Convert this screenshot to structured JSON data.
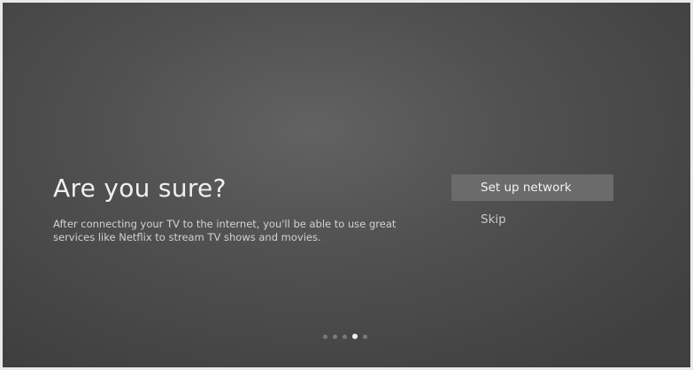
{
  "dialog": {
    "title": "Are you sure?",
    "description_lines": [
      "After connecting your TV to the internet, you'll be able to use great",
      "services like Netflix to stream TV shows and movies."
    ]
  },
  "options": [
    {
      "label": "Set up network",
      "focused": true
    },
    {
      "label": "Skip",
      "focused": false
    }
  ],
  "pager": {
    "total": 5,
    "current": 4
  },
  "colors": {
    "background": "#505050",
    "focus_highlight": "#6b6b6b",
    "text": "#efefef",
    "dot_active": "#f2f2f2",
    "dot_inactive": "#7a7a7a"
  }
}
